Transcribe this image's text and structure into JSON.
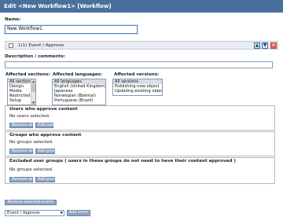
{
  "window": {
    "title": "Edit <New Workflow1> [Workflow]"
  },
  "form": {
    "name_label": "Name:",
    "name_value": "New Workflow1"
  },
  "event": {
    "label": "1(1) Event / Approve"
  },
  "description": {
    "label": "Description / comments:",
    "value": ""
  },
  "sections": {
    "label": "Affected sections:",
    "items": [
      "All sections",
      "Design",
      "Media",
      "Restricted",
      "Setup"
    ],
    "selected": "All sections"
  },
  "languages": {
    "label": "Affected languages:",
    "items": [
      "All languages",
      "English (United Kingdom)",
      "Japanese",
      "Norwegian (Bokmal)",
      "Portuguese (Brazil)"
    ],
    "selected": "All languages"
  },
  "versions": {
    "label": "Affected versions:",
    "items": [
      "All versions",
      "Publishing new object",
      "Updating existing object"
    ],
    "selected": "All versions"
  },
  "approve_users": {
    "title": "Users who approve content",
    "message": "No users selected.",
    "remove_label": "Remove selected",
    "add_label": "Add users"
  },
  "approve_groups": {
    "title": "Groups who approve content",
    "message": "No groups selected.",
    "remove_label": "Remove selected",
    "add_label": "Add groups"
  },
  "excluded_groups": {
    "title": "Excluded user groups ( users in these groups do not need to have their content approved )",
    "message": "No groups selected.",
    "remove_label": "Remove selected",
    "add_label": "Add groups"
  },
  "footer": {
    "remove_events_label": "Remove selected events",
    "event_type_value": "Event / Approve",
    "add_event_label": "Add event"
  },
  "colors": {
    "title_bar": "#4b6f9c",
    "button": "#8ea4c2",
    "focus": "#5b86c8"
  },
  "icons": [
    "move-up-icon",
    "move-down-icon",
    "delete-icon",
    "checkbox-icon",
    "dropdown-caret-icon"
  ]
}
